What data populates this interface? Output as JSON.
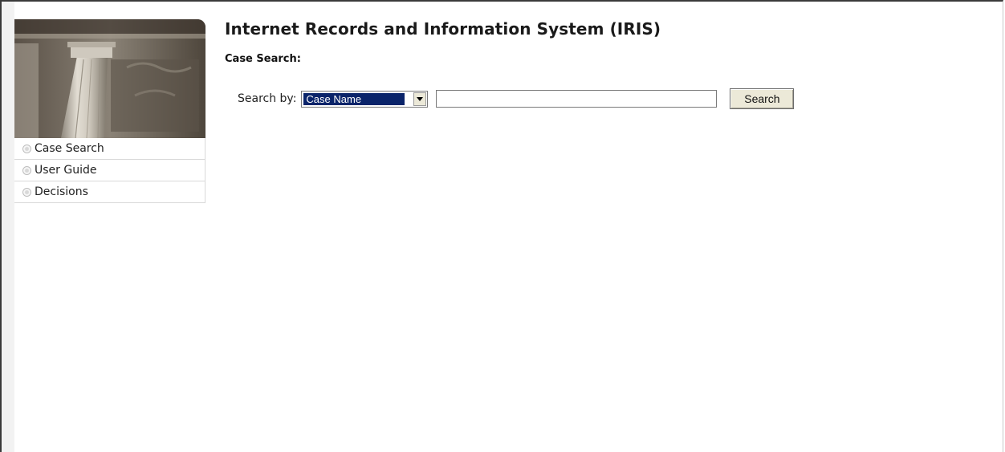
{
  "header": {
    "title": "Internet Records and Information System (IRIS)"
  },
  "sidebar": {
    "banner_image": "courthouse-column-photo",
    "items": [
      {
        "label": "Case Search",
        "icon": "bullet-icon"
      },
      {
        "label": "User Guide",
        "icon": "bullet-icon"
      },
      {
        "label": "Decisions",
        "icon": "bullet-icon"
      }
    ]
  },
  "main": {
    "section_title": "Case Search:",
    "search": {
      "label": "Search by:",
      "selected_option": "Case Name",
      "input_value": "",
      "button_label": "Search"
    }
  },
  "colors": {
    "select_highlight": "#0a246a",
    "button_face": "#ece9d8",
    "nav_border": "#d9d9d9"
  }
}
